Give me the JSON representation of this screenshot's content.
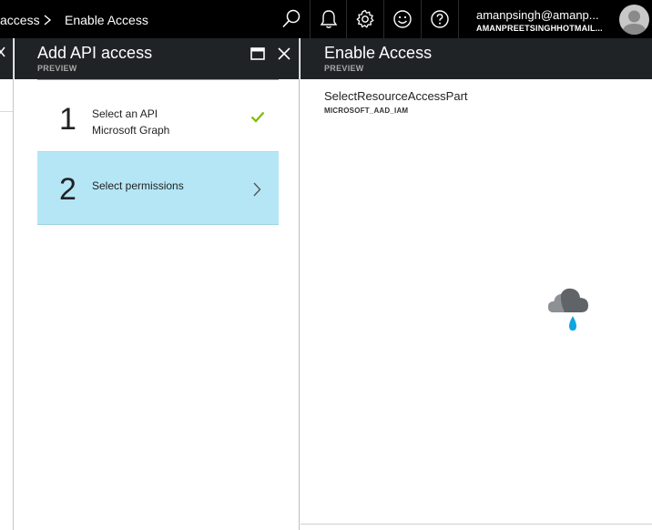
{
  "breadcrumb": {
    "previous": "access",
    "current": "Enable Access"
  },
  "topbar": {
    "icons": [
      "search-icon",
      "bell-icon",
      "gear-icon",
      "smile-icon",
      "help-icon"
    ],
    "user_name": "amanpsingh@amanp...",
    "user_directory": "AMANPREETSINGHHOTMAIL..."
  },
  "blade_add_api": {
    "title": "Add API access",
    "subtitle": "PREVIEW",
    "steps": [
      {
        "number": "1",
        "label": "Select an API",
        "value": "Microsoft Graph",
        "status": "complete"
      },
      {
        "number": "2",
        "label": "Select permissions",
        "value": "",
        "status": "active"
      }
    ]
  },
  "blade_enable_access": {
    "title": "Enable Access",
    "subtitle": "PREVIEW",
    "part_name": "SelectResourceAccessPart",
    "part_extension": "MICROSOFT_AAD_IAM"
  },
  "colors": {
    "topbar_bg": "#000000",
    "blade_header_bg": "#1f2326",
    "selected_step_bg": "#b4e6f6",
    "check_green": "#7fba00",
    "rain_blue": "#0ea5e0"
  }
}
